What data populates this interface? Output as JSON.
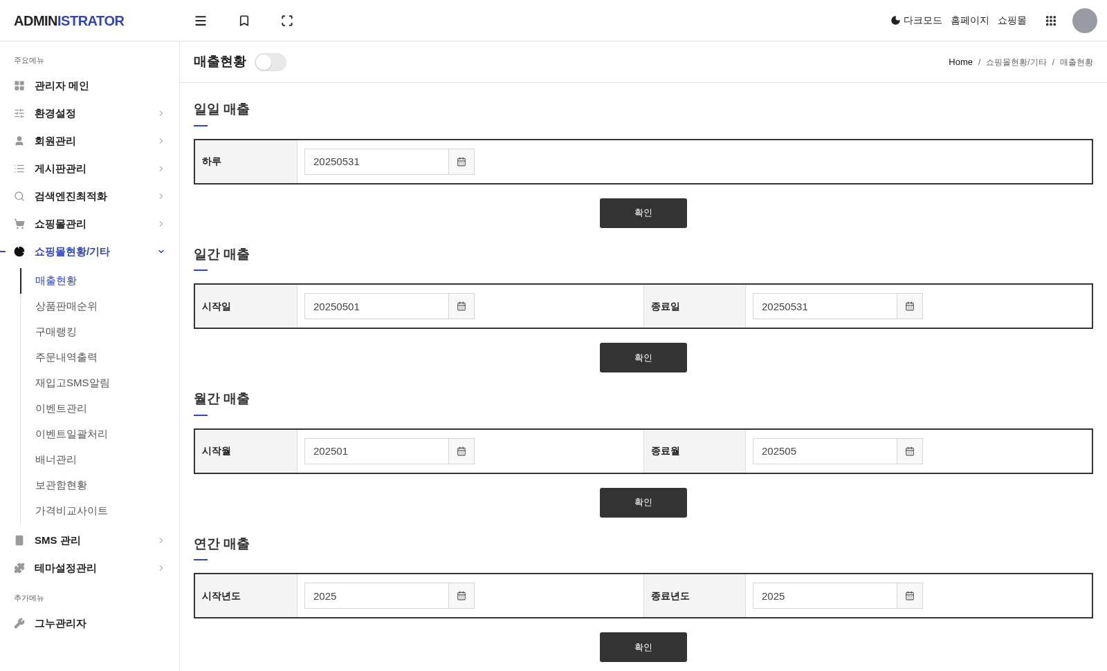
{
  "logo": {
    "part_1": "ADMIN",
    "part_2": "ISTRATOR"
  },
  "header_links": [
    "다크모드",
    "홈페이지",
    "쇼핑몰"
  ],
  "sidebar": {
    "groups": [
      {
        "title": "주요메뉴",
        "items": [
          {
            "label": "관리자 메인",
            "selected": false
          },
          {
            "label": "환경설정",
            "selected": false,
            "expanded": false
          },
          {
            "label": "회원관리",
            "selected": false,
            "expanded": false
          },
          {
            "label": "게시판관리",
            "selected": false,
            "expanded": false
          },
          {
            "label": "검색엔진최적화",
            "selected": false,
            "expanded": false
          },
          {
            "label": "쇼핑몰관리",
            "selected": false,
            "expanded": false
          },
          {
            "label": "쇼핑몰현황/기타",
            "selected": true,
            "expanded": true,
            "children": [
              {
                "label": "매출현황",
                "selected": true
              },
              {
                "label": "상품판매순위",
                "selected": false
              },
              {
                "label": "구매랭킹",
                "selected": false
              },
              {
                "label": "주문내역출력",
                "selected": false
              },
              {
                "label": "재입고SMS알림",
                "selected": false
              },
              {
                "label": "이벤트관리",
                "selected": false
              },
              {
                "label": "이벤트일괄처리",
                "selected": false
              },
              {
                "label": "배너관리",
                "selected": false
              },
              {
                "label": "보관함현황",
                "selected": false
              },
              {
                "label": "가격비교사이트",
                "selected": false
              }
            ]
          },
          {
            "label": "SMS 관리",
            "selected": false,
            "expanded": false
          },
          {
            "label": "테마설정관리",
            "selected": false,
            "expanded": false
          }
        ]
      },
      {
        "title": "추가메뉴",
        "items": [
          {
            "label": "그누관리자",
            "selected": false
          }
        ]
      }
    ]
  },
  "page": {
    "title": "매출현황",
    "toggle": {
      "on": false
    },
    "breadcrumb": [
      "Home",
      "쇼핑몰현황/기타",
      "매출현황"
    ],
    "breadcrumb_separators": [
      "/",
      "/"
    ]
  },
  "sections": [
    {
      "title": "일일 매출",
      "fields": [
        {
          "label": "하루",
          "value": "20250531"
        }
      ],
      "button": "확인"
    },
    {
      "title": "일간 매출",
      "fields": [
        {
          "label": "시작일",
          "value": "20250501"
        },
        {
          "label": "종료일",
          "value": "20250531"
        }
      ],
      "button": "확인"
    },
    {
      "title": "월간 매출",
      "fields": [
        {
          "label": "시작월",
          "value": "202501"
        },
        {
          "label": "종료월",
          "value": "202505"
        }
      ],
      "button": "확인"
    },
    {
      "title": "연간 매출",
      "fields": [
        {
          "label": "시작년도",
          "value": "2025"
        },
        {
          "label": "종료년도",
          "value": "2025"
        }
      ],
      "button": "확인"
    }
  ]
}
